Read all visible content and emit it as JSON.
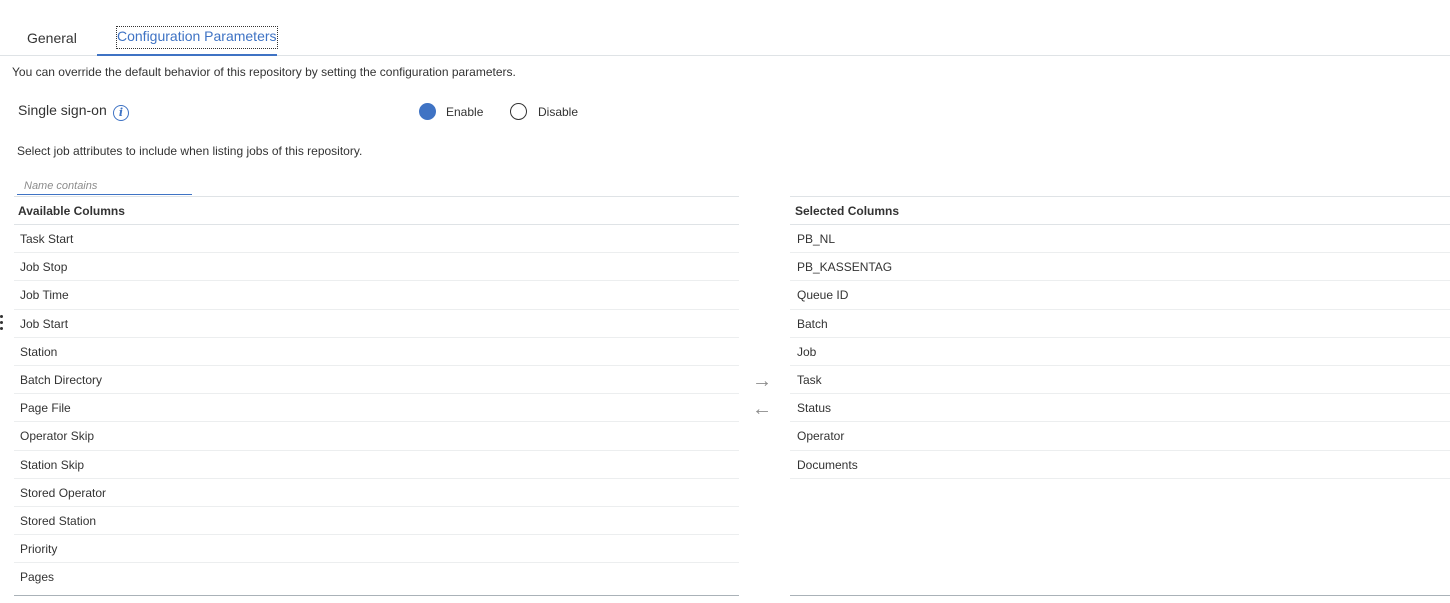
{
  "tabs": [
    {
      "label": "General",
      "active": false
    },
    {
      "label": "Configuration Parameters",
      "active": true
    }
  ],
  "intro_text": "You can override the default behavior of this repository by setting the configuration parameters.",
  "sso": {
    "label": "Single sign-on",
    "info_icon": "info-icon",
    "options": [
      {
        "label": "Enable",
        "selected": true
      },
      {
        "label": "Disable",
        "selected": false
      }
    ]
  },
  "select_note": "Select job attributes to include when listing jobs of this repository.",
  "filter": {
    "placeholder": "Name contains",
    "value": ""
  },
  "available": {
    "header": "Available Columns",
    "items": [
      "Task Start",
      "Job Stop",
      "Job Time",
      "Job Start",
      "Station",
      "Batch Directory",
      "Page File",
      "Operator Skip",
      "Station Skip",
      "Stored Operator",
      "Stored Station",
      "Priority",
      "Pages"
    ]
  },
  "selected": {
    "header": "Selected Columns",
    "items": [
      "PB_NL",
      "PB_KASSENTAG",
      "Queue ID",
      "Batch",
      "Job",
      "Task",
      "Status",
      "Operator",
      "Documents"
    ]
  },
  "arrows": {
    "right": "→",
    "left": "←"
  },
  "colors": {
    "accent": "#3f73c4",
    "text": "#333333",
    "muted": "#8c8c8c",
    "divider": "#dfe3e6"
  }
}
